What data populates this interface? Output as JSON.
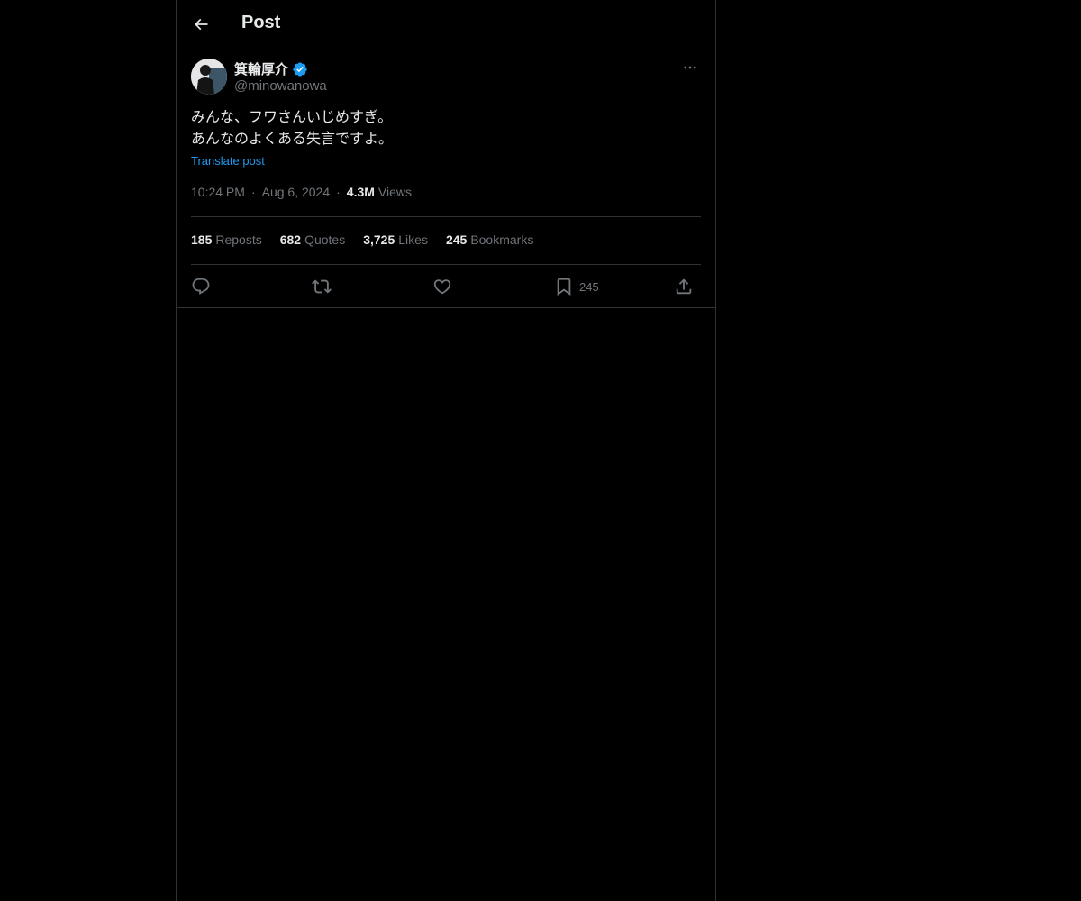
{
  "header": {
    "back_icon": "arrow-left-icon",
    "title": "Post"
  },
  "author": {
    "name": "箕輪厚介",
    "handle": "@minowanowa",
    "verified_icon": "verified-badge-icon",
    "verified_color": "#1d9bf0",
    "more_icon": "more-horizontal-icon"
  },
  "post": {
    "lines": [
      "みんな、フワさんいじめすぎ。",
      "あんなのよくある失言ですよ。"
    ],
    "translate_label": "Translate post",
    "time": "10:24 PM",
    "separator": "·",
    "date": "Aug 6, 2024",
    "views_count": "4.3M",
    "views_label": "Views"
  },
  "stats": {
    "reposts_count": "185",
    "reposts_label": "Reposts",
    "quotes_count": "682",
    "quotes_label": "Quotes",
    "likes_count": "3,725",
    "likes_label": "Likes",
    "bookmarks_count": "245",
    "bookmarks_label": "Bookmarks"
  },
  "actions": {
    "reply_icon": "reply-icon",
    "repost_icon": "repost-icon",
    "like_icon": "heart-icon",
    "bookmark_icon": "bookmark-icon",
    "bookmark_count": "245",
    "share_icon": "share-icon"
  },
  "colors": {
    "background": "#000000",
    "text": "#e7e9ea",
    "secondary": "#71767b",
    "accent": "#1d9bf0",
    "border": "#2f3336"
  }
}
